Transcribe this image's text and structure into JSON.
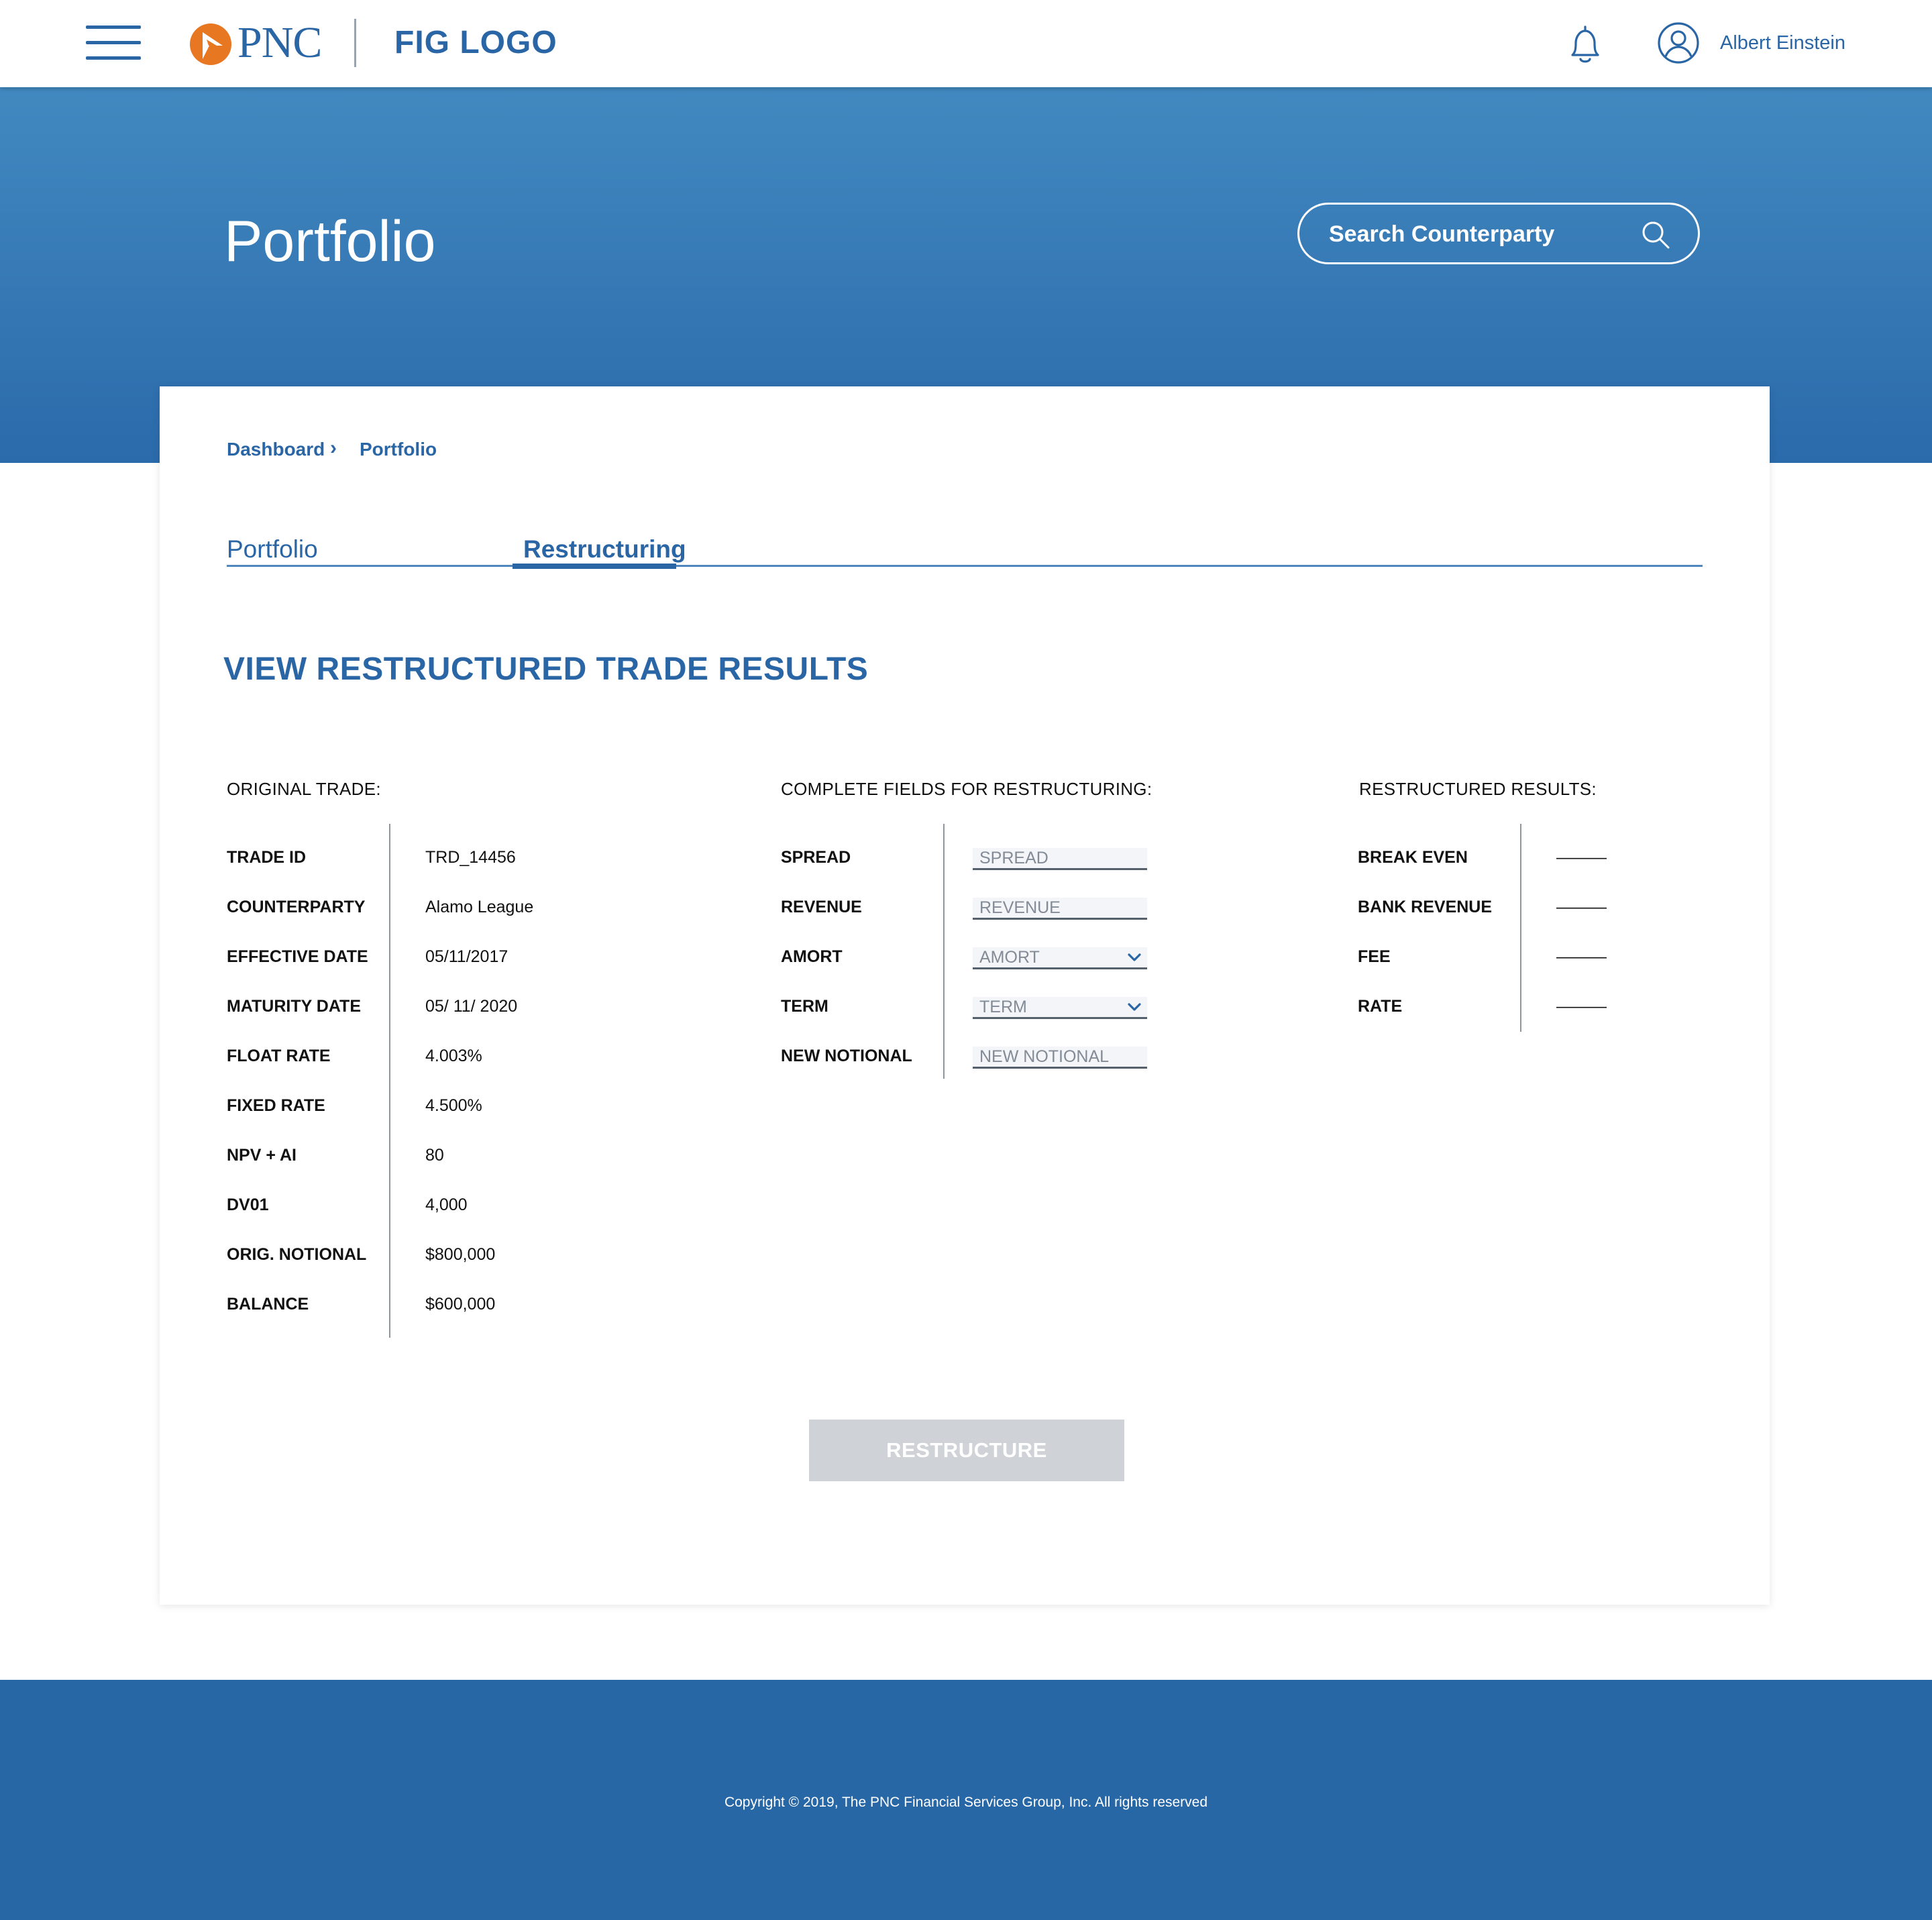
{
  "header": {
    "brand": "PNC",
    "fig_logo": "FIG LOGO",
    "user_name": "Albert Einstein",
    "icons": [
      "menu-icon",
      "pnc-logo-icon",
      "bell-icon",
      "user-icon"
    ]
  },
  "hero": {
    "title": "Portfolio",
    "search_placeholder": "Search Counterparty",
    "search_icon": "search-icon"
  },
  "breadcrumb": {
    "items": [
      "Dashboard",
      "Portfolio"
    ],
    "separator": "›"
  },
  "tabs": [
    {
      "label": "Portfolio",
      "active": false
    },
    {
      "label": "Restructuring",
      "active": true
    }
  ],
  "section_title": "VIEW RESTRUCTURED TRADE RESULTS",
  "original_trade": {
    "heading": "ORIGINAL TRADE:",
    "rows": [
      {
        "label": "TRADE ID",
        "value": "TRD_14456"
      },
      {
        "label": "COUNTERPARTY",
        "value": "Alamo League"
      },
      {
        "label": "EFFECTIVE DATE",
        "value": "05/11/2017"
      },
      {
        "label": "MATURITY DATE",
        "value": "05/ 11/ 2020"
      },
      {
        "label": "FLOAT RATE",
        "value": "4.003%"
      },
      {
        "label": "FIXED RATE",
        "value": "4.500%"
      },
      {
        "label": "NPV + AI",
        "value": "80"
      },
      {
        "label": "DV01",
        "value": "4,000"
      },
      {
        "label": "ORIG. NOTIONAL",
        "value": "$800,000"
      },
      {
        "label": "BALANCE",
        "value": "$600,000"
      }
    ]
  },
  "restructure_fields": {
    "heading": "COMPLETE FIELDS FOR RESTRUCTURING:",
    "fields": [
      {
        "label": "SPREAD",
        "placeholder": "SPREAD",
        "type": "text"
      },
      {
        "label": "REVENUE",
        "placeholder": "REVENUE",
        "type": "text"
      },
      {
        "label": "AMORT",
        "placeholder": "AMORT",
        "type": "select"
      },
      {
        "label": "TERM",
        "placeholder": "TERM",
        "type": "select"
      },
      {
        "label": "NEW NOTIONAL",
        "placeholder": "NEW NOTIONAL",
        "type": "text"
      }
    ]
  },
  "results": {
    "heading": "RESTRUCTURED RESULTS:",
    "rows": [
      {
        "label": "BREAK EVEN",
        "value": "———"
      },
      {
        "label": "BANK REVENUE",
        "value": "———"
      },
      {
        "label": "FEE",
        "value": "———"
      },
      {
        "label": "RATE",
        "value": "———"
      }
    ]
  },
  "actions": {
    "restructure_label": "RESTRUCTURE"
  },
  "footer": {
    "copyright": "Copyright © 2019, The PNC Financial Services Group, Inc. All rights reserved"
  },
  "colors": {
    "brand_blue": "#2a66a5",
    "hero_top": "#4289c0",
    "hero_bottom": "#2b6aab",
    "pnc_orange": "#e87722",
    "footer_blue": "#2867a6",
    "disabled_button": "#cfd2d6"
  }
}
